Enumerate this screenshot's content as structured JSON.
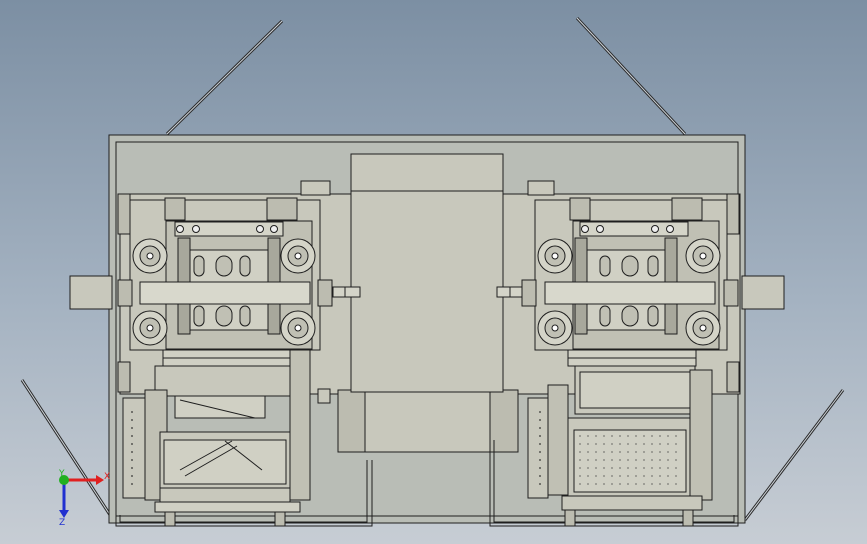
{
  "view": {
    "background_top": "#7c8fa3",
    "background_bottom": "#c7cdd4",
    "part_fill": "#c8c8bc",
    "part_fill_dark": "#b4b4a8",
    "line_color": "#1e1e1e"
  },
  "triad": {
    "x_label": "X",
    "y_label": "Y",
    "z_label": "Z",
    "x_color": "#e02020",
    "y_color": "#20b020",
    "z_color": "#2030d0"
  }
}
